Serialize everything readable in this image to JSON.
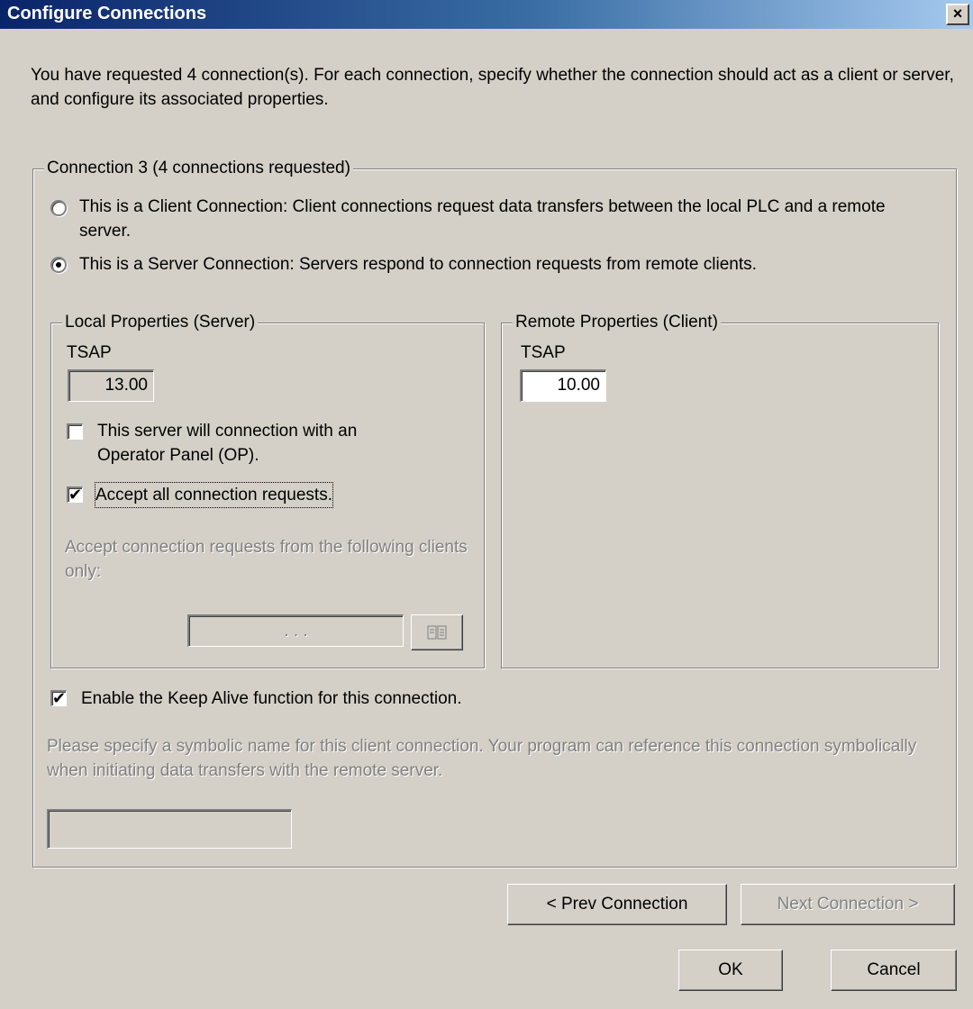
{
  "window": {
    "title": "Configure Connections",
    "close_glyph": "×"
  },
  "intro_text": "You have requested 4 connection(s).  For each connection, specify whether the connection should act as a client or server, and configure its associated properties.",
  "connection_group": {
    "legend": "Connection 3 (4 connections requested)",
    "client_radio_label": "This is a Client Connection: Client connections request data transfers between the local PLC and a remote server.",
    "server_radio_label": "This is a Server Connection: Servers respond to connection requests from remote clients.",
    "selected": "server"
  },
  "local_properties": {
    "legend": "Local Properties (Server)",
    "tsap_label": "TSAP",
    "tsap_value": "13.00",
    "op_checkbox_label": "This server will connection with an Operator Panel (OP).",
    "op_checked": false,
    "accept_all_label": "Accept all connection requests.",
    "accept_all_checked": true,
    "accept_from_label": "Accept connection requests from the following clients only:",
    "ip_placeholder": ".     .     .",
    "browse_icon": "address-book-icon"
  },
  "remote_properties": {
    "legend": "Remote Properties (Client)",
    "tsap_label": "TSAP",
    "tsap_value": "10.00"
  },
  "keep_alive": {
    "label": "Enable the Keep Alive function for this connection.",
    "checked": true
  },
  "symbolic_name": {
    "hint": "Please specify a symbolic name for this client connection.  Your program can reference this connection symbolically when initiating data transfers with the remote server.",
    "value": ""
  },
  "buttons": {
    "prev": "< Prev Connection",
    "next": "Next Connection >",
    "ok": "OK",
    "cancel": "Cancel"
  },
  "colors": {
    "dialog_face": "#d4d0c8",
    "title_gradient_start": "#0a246a",
    "title_gradient_end": "#a6caf0",
    "disabled_text": "#808080"
  }
}
